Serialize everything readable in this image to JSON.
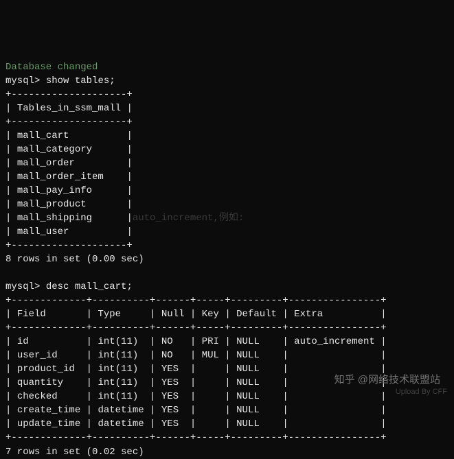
{
  "header_faded": "Database changed",
  "prompt": "mysql>",
  "cmd1": "show tables;",
  "cmd2": "desc mall_cart;",
  "tables_header": "Tables_in_ssm_mall",
  "tables_sep": "+--------------------+",
  "tables_rows": [
    "mall_cart",
    "mall_category",
    "mall_order",
    "mall_order_item",
    "mall_pay_info",
    "mall_product",
    "mall_shipping",
    "mall_user"
  ],
  "result1": "8 rows in set (0.00 sec)",
  "result2": "7 rows in set (0.02 sec)",
  "desc_sep": "+-------------+----------+------+-----+---------+----------------+",
  "desc_header": {
    "field": "Field",
    "type": "Type",
    "null": "Null",
    "key": "Key",
    "default": "Default",
    "extra": "Extra"
  },
  "desc_rows": [
    {
      "field": "id",
      "type": "int(11)",
      "null": "NO",
      "key": "PRI",
      "default": "NULL",
      "extra": "auto_increment"
    },
    {
      "field": "user_id",
      "type": "int(11)",
      "null": "NO",
      "key": "MUL",
      "default": "NULL",
      "extra": ""
    },
    {
      "field": "product_id",
      "type": "int(11)",
      "null": "YES",
      "key": "",
      "default": "NULL",
      "extra": ""
    },
    {
      "field": "quantity",
      "type": "int(11)",
      "null": "YES",
      "key": "",
      "default": "NULL",
      "extra": ""
    },
    {
      "field": "checked",
      "type": "int(11)",
      "null": "YES",
      "key": "",
      "default": "NULL",
      "extra": ""
    },
    {
      "field": "create_time",
      "type": "datetime",
      "null": "YES",
      "key": "",
      "default": "NULL",
      "extra": ""
    },
    {
      "field": "update_time",
      "type": "datetime",
      "null": "YES",
      "key": "",
      "default": "NULL",
      "extra": ""
    }
  ],
  "ghost_text": "auto_increment,例如:",
  "watermark": "知乎 @网络技术联盟站",
  "watermark2": "Upload By CFF"
}
